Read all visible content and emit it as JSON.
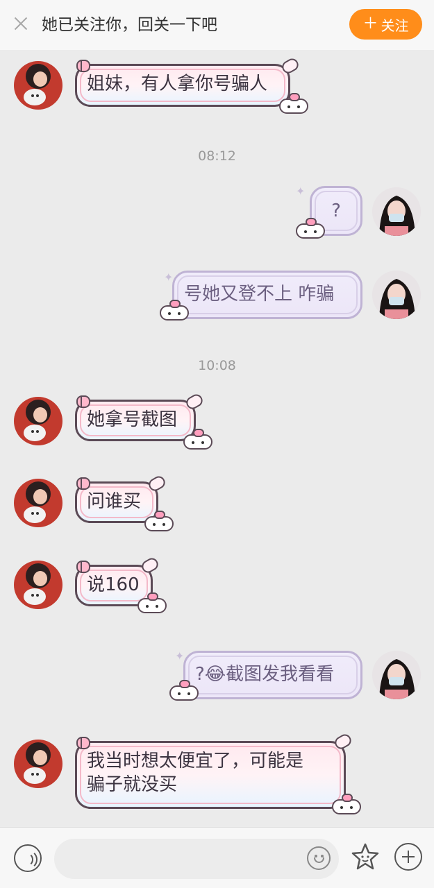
{
  "header": {
    "message": "她已关注你，回关一下吧",
    "follow_plus": "＋",
    "follow_label": "关注"
  },
  "messages": [
    {
      "side": "left",
      "text": "姐妹，有人拿你号骗人"
    },
    {
      "type": "time",
      "text": "08:12"
    },
    {
      "side": "right",
      "text": "?"
    },
    {
      "side": "right",
      "text": "号她又登不上 咋骗"
    },
    {
      "type": "time",
      "text": "10:08"
    },
    {
      "side": "left",
      "text": "她拿号截图"
    },
    {
      "side": "left",
      "text": "问谁买"
    },
    {
      "side": "left",
      "text": "说160"
    },
    {
      "side": "right",
      "text": "?😂截图发我看看"
    },
    {
      "side": "left",
      "text": "我当时想太便宜了，可能是骗子就没买",
      "line1": "我当时想太便宜了，可能是",
      "line2": "骗子就没买"
    }
  ],
  "footer": {
    "voice_icon": "voice-icon",
    "emoji_icon": "smile-icon",
    "sticker_icon": "star-sticker-icon",
    "plus_icon": "plus-icon"
  },
  "colors": {
    "follow_button": "#ff8d1a",
    "background": "#ebebeb"
  }
}
